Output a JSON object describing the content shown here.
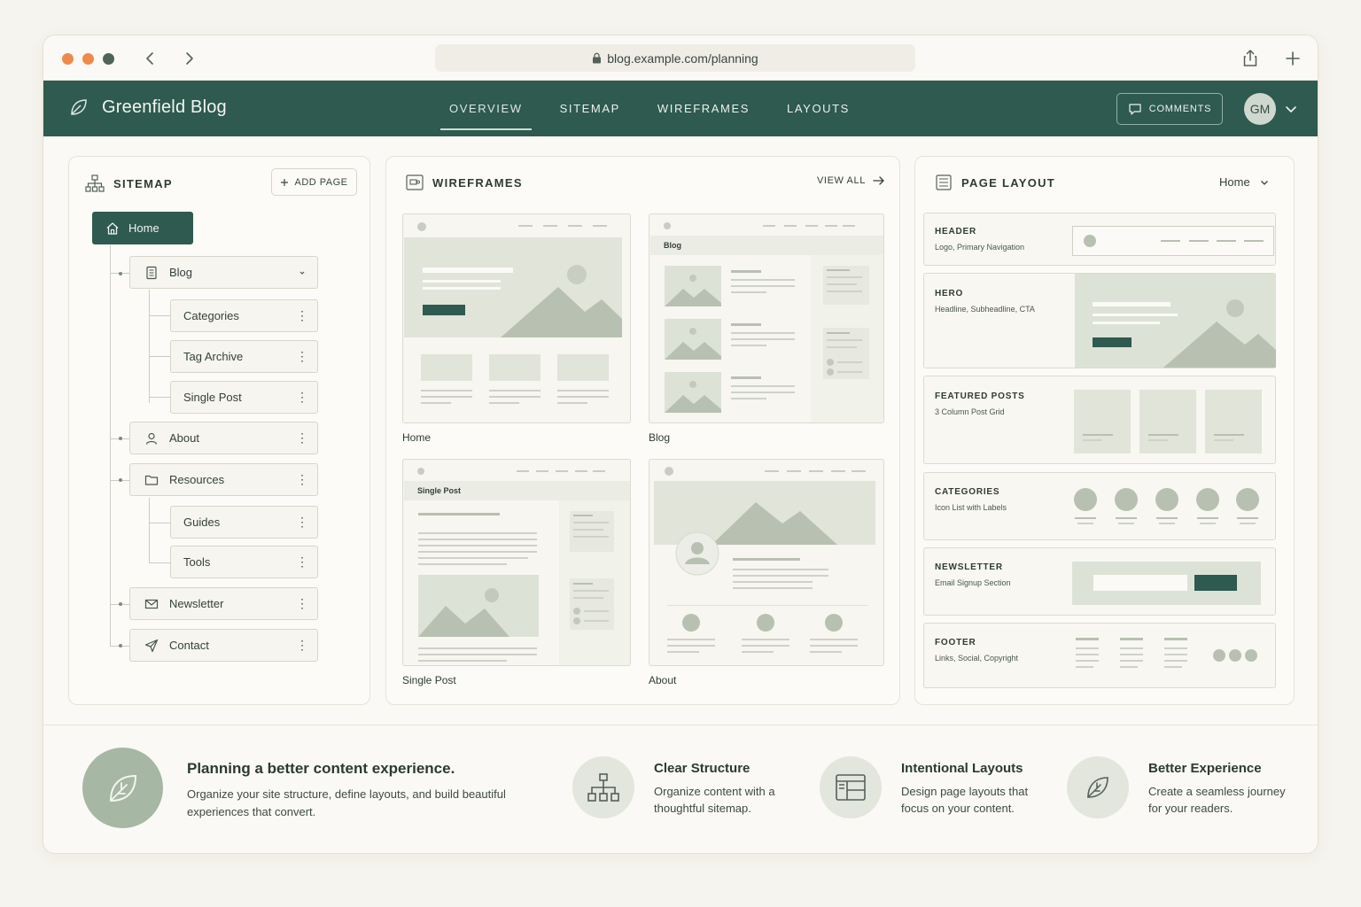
{
  "browser": {
    "url": "blog.example.com/planning"
  },
  "app": {
    "brand": "Greenfield Blog",
    "tabs": [
      "OVERVIEW",
      "SITEMAP",
      "WIREFRAMES",
      "LAYOUTS"
    ],
    "active_tab": "OVERVIEW",
    "comments_label": "COMMENTS",
    "avatar_initials": "GM",
    "colors": {
      "primary": "#2e5a4f",
      "accent": "#ee8b4a",
      "sage": "#a6b7a4"
    }
  },
  "sitemap": {
    "title": "SITEMAP",
    "add_page_label": "ADD PAGE",
    "home": "Home",
    "nodes": [
      {
        "label": "Blog",
        "icon": "document-icon"
      },
      {
        "label": "Categories"
      },
      {
        "label": "Tag Archive"
      },
      {
        "label": "Single Post"
      },
      {
        "label": "About",
        "icon": "user-icon"
      },
      {
        "label": "Resources",
        "icon": "folder-icon"
      },
      {
        "label": "Guides"
      },
      {
        "label": "Tools"
      },
      {
        "label": "Newsletter",
        "icon": "mail-icon"
      },
      {
        "label": "Contact",
        "icon": "send-icon"
      }
    ]
  },
  "wireframes": {
    "title": "WIREFRAMES",
    "view_all_label": "VIEW ALL",
    "cards": [
      {
        "label": "Home"
      },
      {
        "label": "Blog",
        "inner_label": "Blog"
      },
      {
        "label": "Single Post",
        "inner_label": "Single Post"
      },
      {
        "label": "About"
      }
    ]
  },
  "page_layout": {
    "title": "PAGE LAYOUT",
    "selected_page": "Home",
    "sections": [
      {
        "title": "HEADER",
        "subtitle": "Logo, Primary Navigation"
      },
      {
        "title": "HERO",
        "subtitle": "Headline, Subheadline, CTA"
      },
      {
        "title": "FEATURED POSTS",
        "subtitle": "3 Column Post Grid"
      },
      {
        "title": "CATEGORIES",
        "subtitle": "Icon List with Labels"
      },
      {
        "title": "NEWSLETTER",
        "subtitle": "Email Signup Section"
      },
      {
        "title": "FOOTER",
        "subtitle": "Links, Social, Copyright"
      }
    ]
  },
  "footer": {
    "headline": "Planning a better content experience.",
    "text": "Organize your site structure, define layouts, and build beautiful experiences that convert.",
    "features": [
      {
        "title": "Clear Structure",
        "text": "Organize content with a thoughtful sitemap.",
        "icon": "sitemap-icon"
      },
      {
        "title": "Intentional Layouts",
        "text": "Design page layouts that focus on your content.",
        "icon": "layout-icon"
      },
      {
        "title": "Better Experience",
        "text": "Create a seamless journey for your readers.",
        "icon": "leaf-icon"
      }
    ]
  }
}
